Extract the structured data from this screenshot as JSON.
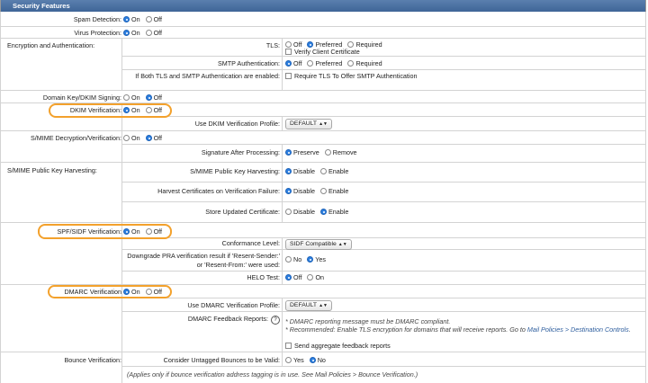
{
  "section_title": "Security Features",
  "spam": {
    "label": "Spam Detection:",
    "on": "On",
    "off": "Off"
  },
  "virus": {
    "label": "Virus Protection:",
    "on": "On",
    "off": "Off"
  },
  "enc": {
    "label": "Encryption and Authentication:",
    "tls": {
      "label": "TLS:",
      "off": "Off",
      "preferred": "Preferred",
      "required": "Required",
      "verify": "Verify Client Certificate"
    },
    "smtp": {
      "label": "SMTP Authentication:",
      "off": "Off",
      "preferred": "Preferred",
      "required": "Required"
    },
    "both": {
      "label": "If Both TLS and SMTP Authentication are enabled:",
      "check": "Require TLS To Offer SMTP Authentication"
    }
  },
  "dkim_sign": {
    "label": "Domain Key/DKIM Signing:",
    "on": "On",
    "off": "Off"
  },
  "dkim_verify": {
    "label": "DKIM Verification:",
    "on": "On",
    "off": "Off",
    "profile_label": "Use DKIM Verification Profile:",
    "profile_value": "DEFAULT"
  },
  "smime_decrypt": {
    "label": "S/MIME Decryption/Verification:",
    "on": "On",
    "off": "Off",
    "sig_label": "Signature After Processing:",
    "preserve": "Preserve",
    "remove": "Remove"
  },
  "smime_harvest": {
    "label": "S/MIME Public Key Harvesting:",
    "pk_label": "S/MIME Public Key Harvesting:",
    "hc_label": "Harvest Certificates on Verification Failure:",
    "su_label": "Store Updated Certificate:",
    "disable": "Disable",
    "enable": "Enable"
  },
  "spf": {
    "label": "SPF/SIDF Verification:",
    "on": "On",
    "off": "Off",
    "conf_label": "Conformance Level:",
    "conf_value": "SIDF Compatible",
    "pra_label": "Downgrade PRA verification result if 'Resent-Sender:' or 'Resent-From:' were used:",
    "no": "No",
    "yes": "Yes",
    "helo_label": "HELO Test:",
    "helo_off": "Off",
    "helo_on": "On"
  },
  "dmarc": {
    "label": "DMARC Verification",
    "on": "On",
    "off": "Off",
    "profile_label": "Use DMARC Verification Profile:",
    "profile_value": "DEFAULT",
    "feedback_label": "DMARC Feedback Reports:",
    "note1": "* DMARC reporting message must be DMARC compliant.",
    "note2a": "* Recommended: Enable TLS encryption for domains that will receive reports. Go to ",
    "note2link": "Mail Policies > Destination Controls",
    "note2b": ".",
    "send": "Send aggregate feedback reports"
  },
  "bounce": {
    "label": "Bounce Verification:",
    "cons_label": "Consider Untagged Bounces to be Valid:",
    "yes": "Yes",
    "no": "No",
    "note": "(Applies only if bounce verification address tagging is in use. See Mail Policies > Bounce Verification.)"
  }
}
